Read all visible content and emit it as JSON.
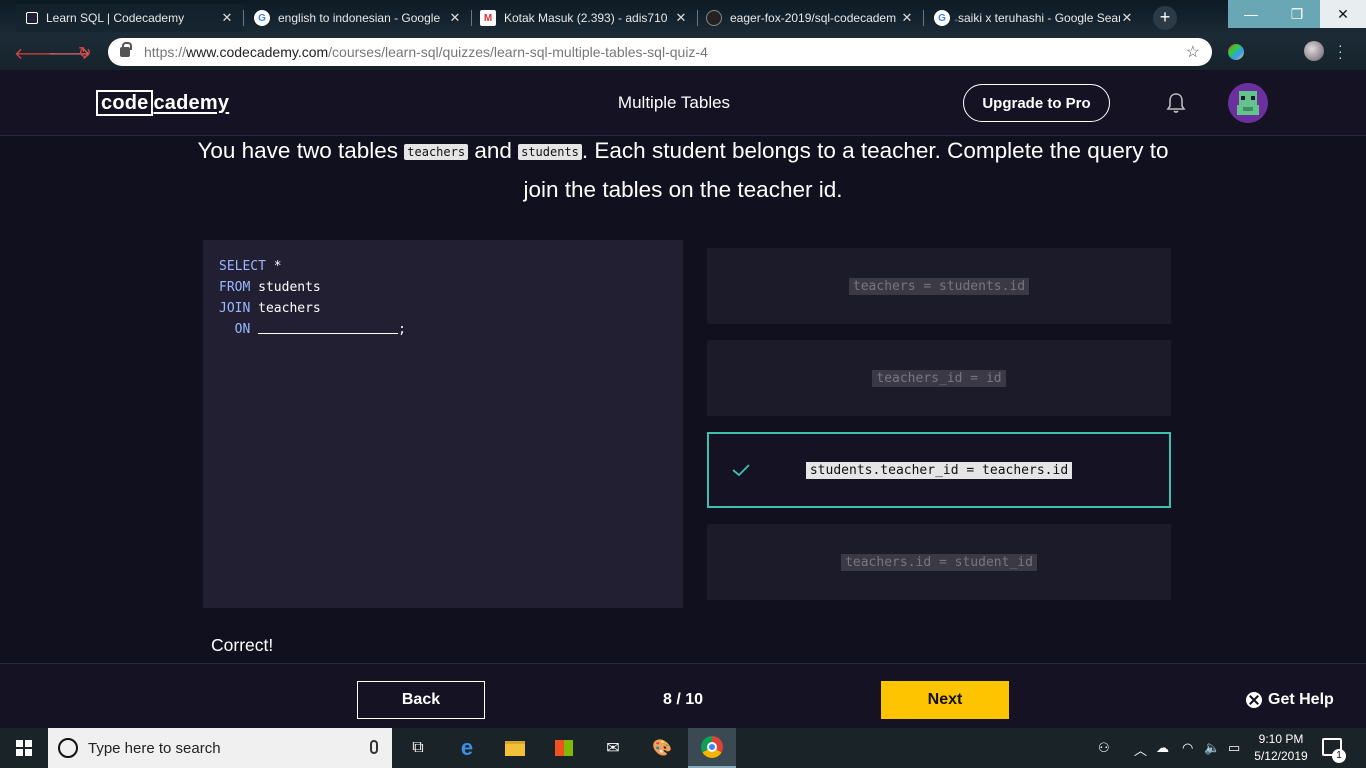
{
  "browser": {
    "tabs": [
      {
        "title": "Learn SQL | Codecademy",
        "icon": "codecademy-icon",
        "active": true
      },
      {
        "title": "english to indonesian - Google",
        "icon": "google-icon"
      },
      {
        "title": "Kotak Masuk (2.393) - adis710",
        "icon": "gmail-icon"
      },
      {
        "title": "eager-fox-2019/sql-codecadem",
        "icon": "github-icon"
      },
      {
        "title": "saiki x teruhashi - Google Sear",
        "icon": "google-icon"
      }
    ],
    "new_tab": "+",
    "address": {
      "scheme": "https://",
      "host": "www.codecademy.com",
      "path": "/courses/learn-sql/quizzes/learn-sql-multiple-tables-sql-quiz-4"
    },
    "window_controls": {
      "minimize": "—",
      "maximize": "❐",
      "close": "✕"
    }
  },
  "header": {
    "logo_code": "code",
    "logo_rest": "cademy",
    "title": "Multiple Tables",
    "upgrade_label": "Upgrade to Pro"
  },
  "question": {
    "part1": "You have two tables ",
    "table1": "teachers",
    "part2": " and ",
    "table2": "students",
    "part3": ". Each student belongs to a teacher. Complete the query to join the tables on the teacher id."
  },
  "code": {
    "lines": [
      {
        "kw": "SELECT",
        "rest": " *"
      },
      {
        "kw": "FROM",
        "rest": " students"
      },
      {
        "kw": "JOIN",
        "rest": " teachers"
      },
      {
        "kw": "  ON",
        "rest": " ",
        "end": ";"
      }
    ]
  },
  "options": [
    {
      "text": "teachers = students.id",
      "selected": false
    },
    {
      "text": "teachers_id = id",
      "selected": false
    },
    {
      "text": "students.teacher_id = teachers.id",
      "selected": true
    },
    {
      "text": "teachers.id = student_id",
      "selected": false
    }
  ],
  "feedback": "Correct!",
  "footer": {
    "back_label": "Back",
    "progress": "8 / 10",
    "progress_current": 8,
    "progress_total": 10,
    "next_label": "Next",
    "help_label": "Get Help"
  },
  "taskbar": {
    "search_placeholder": "Type here to search",
    "time": "9:10 PM",
    "date": "5/12/2019",
    "notification_count": "1"
  },
  "colors": {
    "accent_yellow": "#ffc400",
    "correct_teal": "#3fbfae",
    "keyword_blue": "#98b8ff",
    "background": "#11101e"
  }
}
